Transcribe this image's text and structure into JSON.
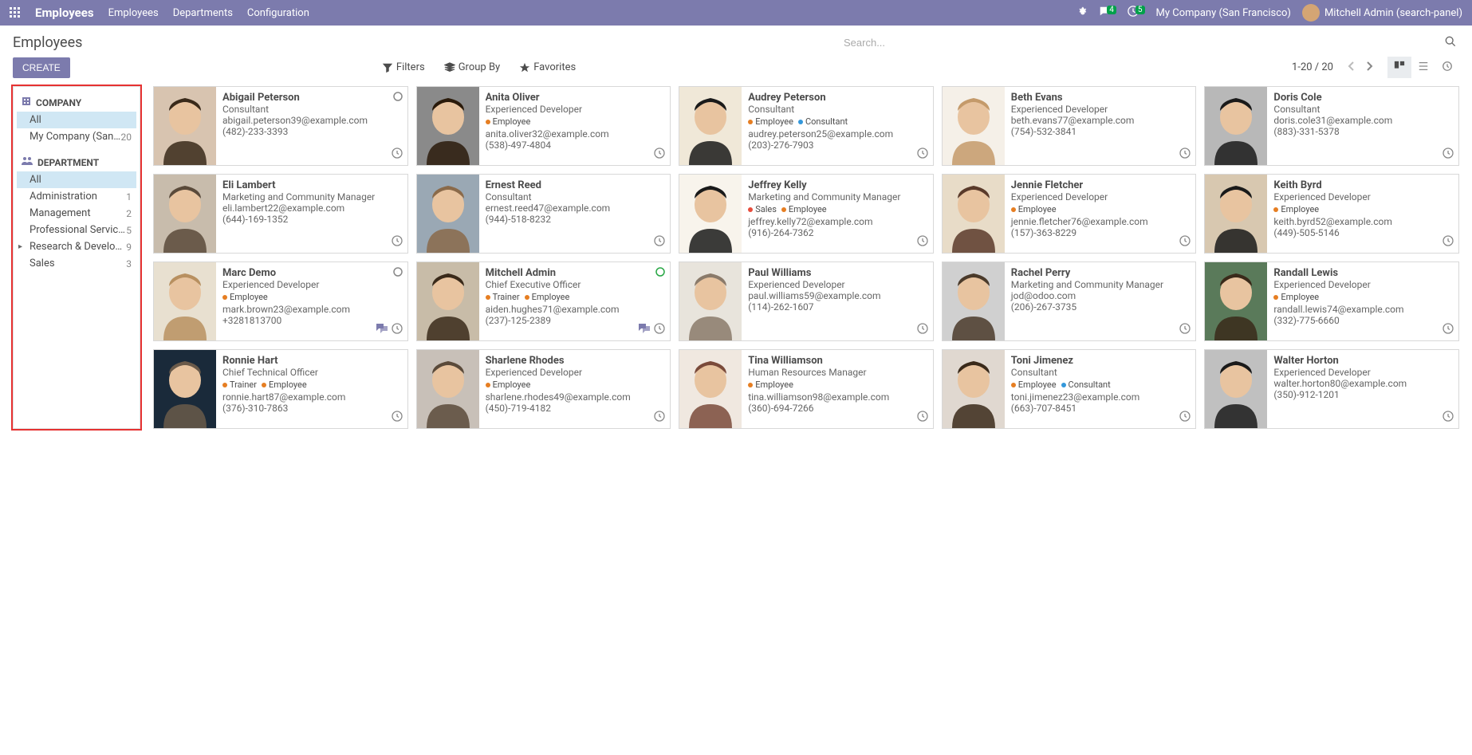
{
  "topnav": {
    "brand": "Employees",
    "links": [
      "Employees",
      "Departments",
      "Configuration"
    ],
    "messages_count": "4",
    "activities_count": "5",
    "company": "My Company (San Francisco)",
    "user": "Mitchell Admin (search-panel)"
  },
  "breadcrumb": "Employees",
  "search": {
    "placeholder": "Search..."
  },
  "buttons": {
    "create": "CREATE"
  },
  "searchopts": {
    "filters": "Filters",
    "groupby": "Group By",
    "favorites": "Favorites"
  },
  "pager": "1-20 / 20",
  "sidebar": {
    "company": {
      "header": "COMPANY",
      "items": [
        {
          "label": "All",
          "count": "",
          "selected": true
        },
        {
          "label": "My Company (San …",
          "count": "20"
        }
      ]
    },
    "department": {
      "header": "DEPARTMENT",
      "items": [
        {
          "label": "All",
          "count": "",
          "selected": true
        },
        {
          "label": "Administration",
          "count": "1"
        },
        {
          "label": "Management",
          "count": "2"
        },
        {
          "label": "Professional Services",
          "count": "5"
        },
        {
          "label": "Research & Develop…",
          "count": "9",
          "caret": true
        },
        {
          "label": "Sales",
          "count": "3"
        }
      ]
    }
  },
  "tag_colors": {
    "Employee": "#e67e22",
    "Consultant": "#3498db",
    "Trainer": "#e67e22",
    "Sales": "#e74c3c"
  },
  "employees": [
    {
      "name": "Abigail Peterson",
      "title": "Consultant",
      "tags": [],
      "email": "abigail.peterson39@example.com",
      "phone": "(482)-233-3393",
      "presence": "offline",
      "chat": false,
      "clock": true,
      "bg": "#d8c4b0",
      "hair": "#3a2a1a"
    },
    {
      "name": "Anita Oliver",
      "title": "Experienced Developer",
      "tags": [
        "Employee"
      ],
      "email": "anita.oliver32@example.com",
      "phone": "(538)-497-4804",
      "presence": "",
      "chat": false,
      "clock": true,
      "bg": "#8a8a8a",
      "hair": "#2a1a0a"
    },
    {
      "name": "Audrey Peterson",
      "title": "Consultant",
      "tags": [
        "Employee",
        "Consultant"
      ],
      "email": "audrey.peterson25@example.com",
      "phone": "(203)-276-7903",
      "presence": "",
      "chat": false,
      "clock": true,
      "bg": "#f0e8d8",
      "hair": "#1a1a1a"
    },
    {
      "name": "Beth Evans",
      "title": "Experienced Developer",
      "tags": [],
      "email": "beth.evans77@example.com",
      "phone": "(754)-532-3841",
      "presence": "",
      "chat": false,
      "clock": true,
      "bg": "#f5f0e8",
      "hair": "#c49a6a"
    },
    {
      "name": "Doris Cole",
      "title": "Consultant",
      "tags": [],
      "email": "doris.cole31@example.com",
      "phone": "(883)-331-5378",
      "presence": "",
      "chat": false,
      "clock": true,
      "bg": "#b8b8b8",
      "hair": "#1a1a1a"
    },
    {
      "name": "Eli Lambert",
      "title": "Marketing and Community Manager",
      "tags": [],
      "email": "eli.lambert22@example.com",
      "phone": "(644)-169-1352",
      "presence": "",
      "chat": false,
      "clock": true,
      "bg": "#c8bcac",
      "hair": "#5a4a3a"
    },
    {
      "name": "Ernest Reed",
      "title": "Consultant",
      "tags": [],
      "email": "ernest.reed47@example.com",
      "phone": "(944)-518-8232",
      "presence": "",
      "chat": false,
      "clock": true,
      "bg": "#9aa8b4",
      "hair": "#8a6a4a"
    },
    {
      "name": "Jeffrey Kelly",
      "title": "Marketing and Community Manager",
      "tags": [
        "Sales",
        "Employee"
      ],
      "email": "jeffrey.kelly72@example.com",
      "phone": "(916)-264-7362",
      "presence": "",
      "chat": false,
      "clock": true,
      "bg": "#f8f4ec",
      "hair": "#1a1a1a"
    },
    {
      "name": "Jennie Fletcher",
      "title": "Experienced Developer",
      "tags": [
        "Employee"
      ],
      "email": "jennie.fletcher76@example.com",
      "phone": "(157)-363-8229",
      "presence": "",
      "chat": false,
      "clock": true,
      "bg": "#e8dcc8",
      "hair": "#5a3a2a"
    },
    {
      "name": "Keith Byrd",
      "title": "Experienced Developer",
      "tags": [
        "Employee"
      ],
      "email": "keith.byrd52@example.com",
      "phone": "(449)-505-5146",
      "presence": "",
      "chat": false,
      "clock": true,
      "bg": "#d8c8b0",
      "hair": "#1a1a1a"
    },
    {
      "name": "Marc Demo",
      "title": "Experienced Developer",
      "tags": [
        "Employee"
      ],
      "email": "mark.brown23@example.com",
      "phone": "+3281813700",
      "presence": "offline",
      "chat": true,
      "clock": true,
      "bg": "#e8e0d0",
      "hair": "#b89060"
    },
    {
      "name": "Mitchell Admin",
      "title": "Chief Executive Officer",
      "tags": [
        "Trainer",
        "Employee"
      ],
      "email": "aiden.hughes71@example.com",
      "phone": "(237)-125-2389",
      "presence": "online",
      "chat": true,
      "clock": true,
      "bg": "#c8bca8",
      "hair": "#3a2a1a"
    },
    {
      "name": "Paul Williams",
      "title": "Experienced Developer",
      "tags": [],
      "email": "paul.williams59@example.com",
      "phone": "(114)-262-1607",
      "presence": "",
      "chat": false,
      "clock": true,
      "bg": "#e8e4dc",
      "hair": "#8a7a6a"
    },
    {
      "name": "Rachel Perry",
      "title": "Marketing and Community Manager",
      "tags": [],
      "email": "jod@odoo.com",
      "phone": "(206)-267-3735",
      "presence": "",
      "chat": false,
      "clock": true,
      "bg": "#d0d0d0",
      "hair": "#4a3a2a"
    },
    {
      "name": "Randall Lewis",
      "title": "Experienced Developer",
      "tags": [
        "Employee"
      ],
      "email": "randall.lewis74@example.com",
      "phone": "(332)-775-6660",
      "presence": "",
      "chat": false,
      "clock": true,
      "bg": "#5a7a5a",
      "hair": "#3a2a1a"
    },
    {
      "name": "Ronnie Hart",
      "title": "Chief Technical Officer",
      "tags": [
        "Trainer",
        "Employee"
      ],
      "email": "ronnie.hart87@example.com",
      "phone": "(376)-310-7863",
      "presence": "",
      "chat": false,
      "clock": true,
      "bg": "#1a2a3a",
      "hair": "#6a5a4a"
    },
    {
      "name": "Sharlene Rhodes",
      "title": "Experienced Developer",
      "tags": [
        "Employee"
      ],
      "email": "sharlene.rhodes49@example.com",
      "phone": "(450)-719-4182",
      "presence": "",
      "chat": false,
      "clock": true,
      "bg": "#c8c0b8",
      "hair": "#5a4a3a"
    },
    {
      "name": "Tina Williamson",
      "title": "Human Resources Manager",
      "tags": [
        "Employee"
      ],
      "email": "tina.williamson98@example.com",
      "phone": "(360)-694-7266",
      "presence": "",
      "chat": false,
      "clock": true,
      "bg": "#f0e8e0",
      "hair": "#7a4a3a"
    },
    {
      "name": "Toni Jimenez",
      "title": "Consultant",
      "tags": [
        "Employee",
        "Consultant"
      ],
      "email": "toni.jimenez23@example.com",
      "phone": "(663)-707-8451",
      "presence": "",
      "chat": false,
      "clock": true,
      "bg": "#e0d8d0",
      "hair": "#3a2a1a"
    },
    {
      "name": "Walter Horton",
      "title": "Experienced Developer",
      "tags": [],
      "email": "walter.horton80@example.com",
      "phone": "(350)-912-1201",
      "presence": "",
      "chat": false,
      "clock": true,
      "bg": "#c0c0c0",
      "hair": "#1a1a1a"
    }
  ]
}
